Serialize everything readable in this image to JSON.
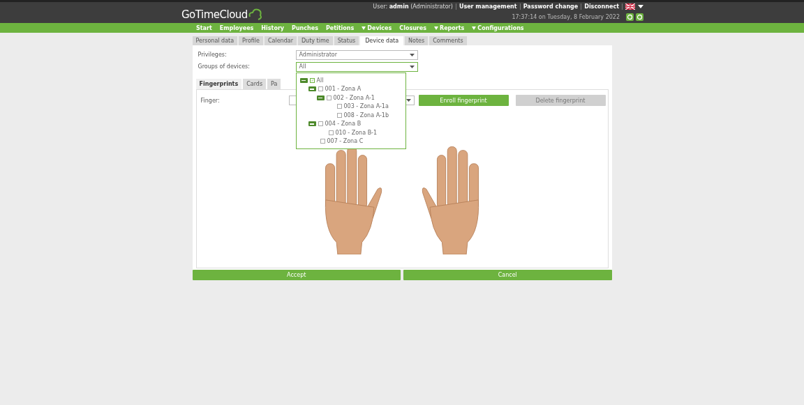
{
  "header": {
    "logo": "GoTimeCloud",
    "user_label": "User:",
    "user_name": "admin",
    "user_role": "(Administrator)",
    "links": [
      "User management",
      "Password change",
      "Disconnect"
    ],
    "datetime": "17:37:14 on Tuesday, 8 February 2022"
  },
  "nav": [
    {
      "label": "Start",
      "has_caret": false
    },
    {
      "label": "Employees",
      "has_caret": false
    },
    {
      "label": "History",
      "has_caret": false
    },
    {
      "label": "Punches",
      "has_caret": false
    },
    {
      "label": "Petitions",
      "has_caret": false
    },
    {
      "label": "Devices",
      "has_caret": true
    },
    {
      "label": "Closures",
      "has_caret": false
    },
    {
      "label": "Reports",
      "has_caret": true
    },
    {
      "label": "Configurations",
      "has_caret": true
    }
  ],
  "tabs": [
    {
      "label": "Personal data",
      "selected": false
    },
    {
      "label": "Profile",
      "selected": false
    },
    {
      "label": "Calendar",
      "selected": false
    },
    {
      "label": "Duty time",
      "selected": false
    },
    {
      "label": "Status",
      "selected": false
    },
    {
      "label": "Device data",
      "selected": true
    },
    {
      "label": "Notes",
      "selected": false
    },
    {
      "label": "Comments",
      "selected": false
    }
  ],
  "fields": [
    {
      "label": "Privileges:",
      "value": "Administrator",
      "open": false
    },
    {
      "label": "Groups of devices:",
      "value": "All",
      "open": true
    }
  ],
  "tree": [
    {
      "label": "All",
      "checked": true,
      "expanded": true,
      "children": [
        {
          "label": "001 - Zona A",
          "checked": false,
          "expanded": true,
          "children": [
            {
              "label": "002 - Zona A-1",
              "checked": false,
              "expanded": true,
              "children": [
                {
                  "label": "003 - Zona A-1a",
                  "checked": false
                },
                {
                  "label": "008 - Zona A-1b",
                  "checked": false
                }
              ]
            }
          ]
        },
        {
          "label": "004 - Zona B",
          "checked": false,
          "expanded": true,
          "children": [
            {
              "label": "010 - Zona B-1",
              "checked": false
            }
          ]
        },
        {
          "label": "007 - Zona C",
          "checked": false
        }
      ]
    }
  ],
  "subtabs": [
    {
      "label": "Fingerprints",
      "selected": true
    },
    {
      "label": "Cards",
      "selected": false
    },
    {
      "label": "Pa",
      "selected": false
    }
  ],
  "finger": {
    "label": "Finger:"
  },
  "actions": [
    {
      "label": "Enroll fingerprint",
      "disabled": false
    },
    {
      "label": "Delete fingerprint",
      "disabled": true
    }
  ],
  "footer_buttons": [
    "Accept",
    "Cancel"
  ]
}
